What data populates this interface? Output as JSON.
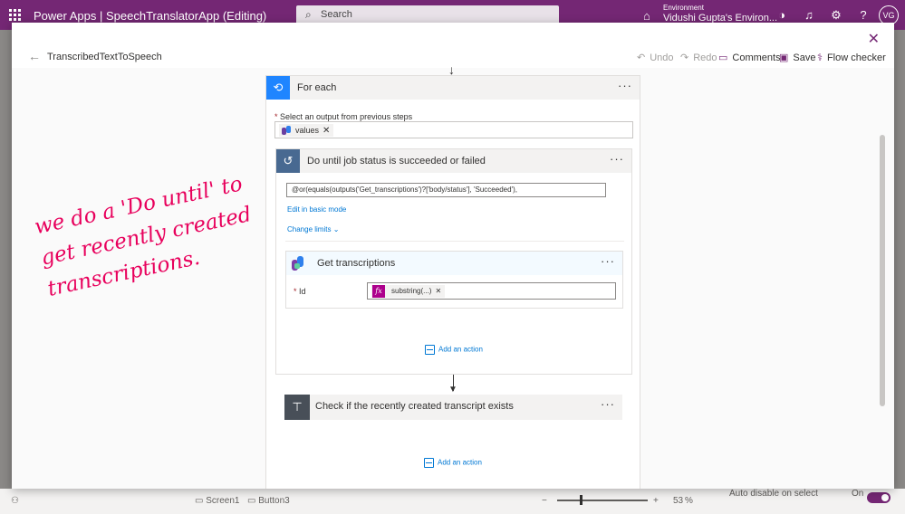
{
  "app_bar": {
    "brand": "Power Apps  |  SpeechTranslatorApp (Editing)",
    "search_placeholder": "Search",
    "environment_label": "Environment",
    "environment_value": "Vidushi Gupta's Environ...",
    "avatar_initials": "VG",
    "icons": [
      "waffle-icon",
      "search-icon",
      "environment-icon",
      "copilot-icon",
      "bell-icon",
      "gear-icon",
      "help-icon"
    ],
    "brand_color": "#742774"
  },
  "status_bar": {
    "screen": "Screen1",
    "button": "Button3",
    "zoom_minus": "−",
    "zoom_plus": "+",
    "zoom_value": "53",
    "zoom_unit": "%",
    "auto_disable": "Auto disable on select",
    "toggle_state": "On"
  },
  "flow": {
    "title": "TranscribedTextToSpeech",
    "toolbar": {
      "undo": "Undo",
      "redo": "Redo",
      "comments": "Comments",
      "save": "Save",
      "flow_checker": "Flow checker"
    }
  },
  "annotation": {
    "line1": "we do a 'Do until' to",
    "line2": "get recently created",
    "line3": "transcriptions."
  },
  "for_each": {
    "title": "For each",
    "more": "···",
    "select_label": "Select an output from previous steps",
    "token": "values",
    "header_color": "#1f85ff"
  },
  "do_until": {
    "title": "Do until job status is succeeded or failed",
    "more": "···",
    "expression": "@or(equals(outputs('Get_transcriptions')?['body/status'], 'Succeeded'),",
    "edit_basic": "Edit in basic mode",
    "change_limits": "Change limits",
    "header_color": "#486991"
  },
  "get_transcriptions": {
    "title": "Get transcriptions",
    "more": "···",
    "id_label": "Id",
    "id_token": "substring(...)"
  },
  "add_action_inner": "Add an action",
  "condition": {
    "title": "Check if the recently created transcript exists",
    "more": "···",
    "header_color": "#484f58"
  },
  "add_action_outer": "Add an action"
}
